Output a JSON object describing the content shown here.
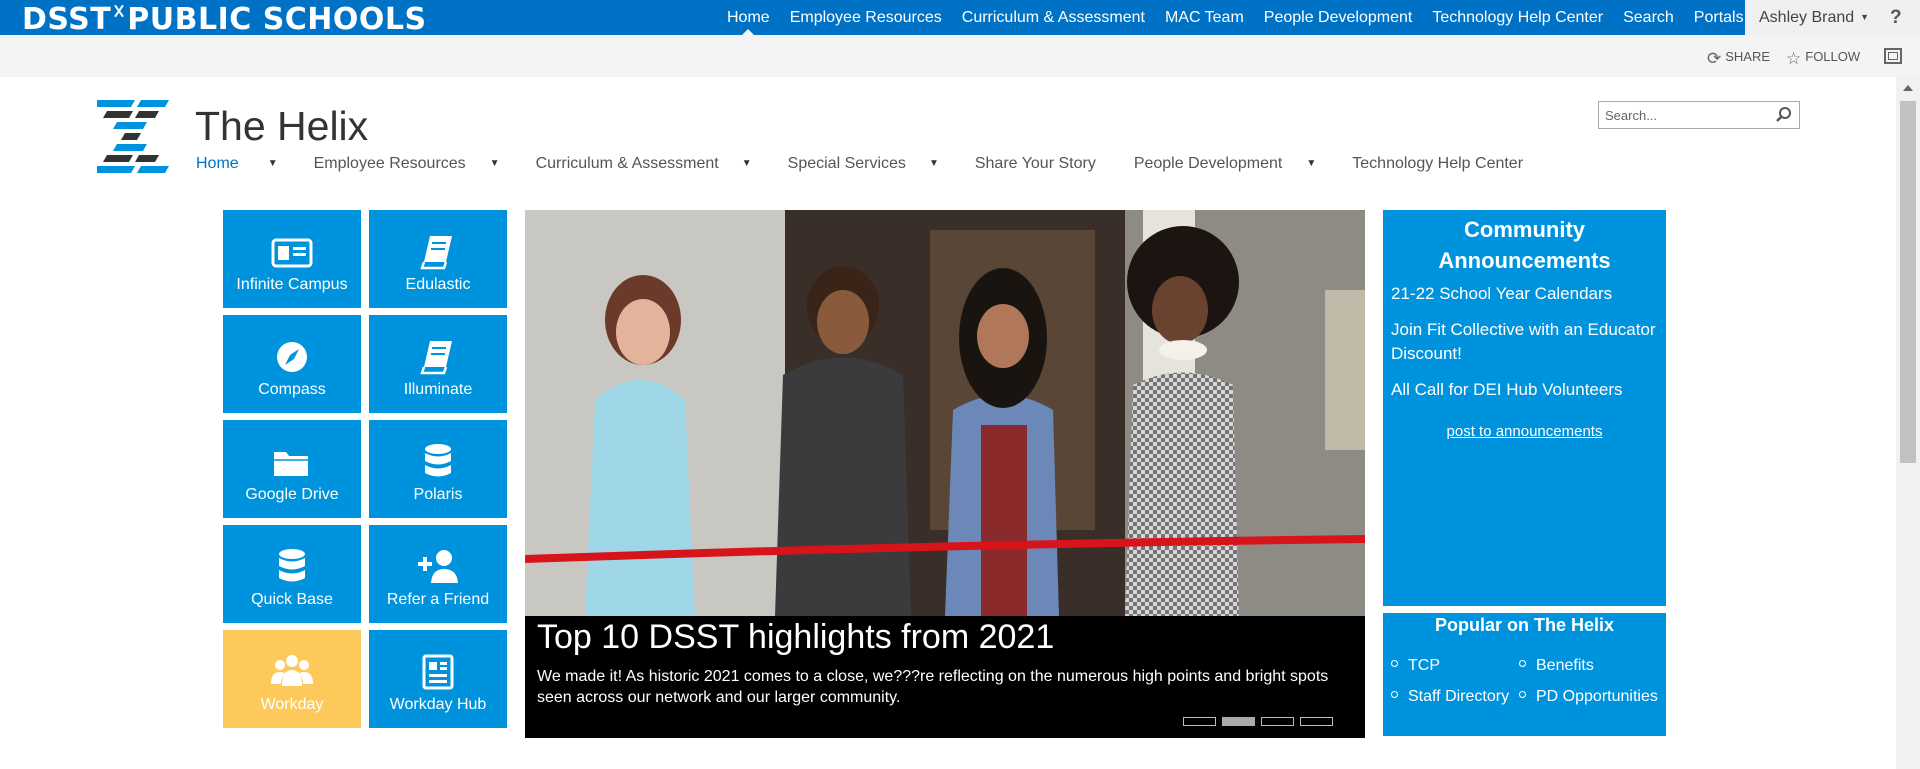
{
  "suite": {
    "brand_left": "DSST",
    "brand_right": "PUBLIC SCHOOLS",
    "nav": [
      {
        "label": "Home"
      },
      {
        "label": "Employee Resources"
      },
      {
        "label": "Curriculum & Assessment"
      },
      {
        "label": "MAC Team"
      },
      {
        "label": "People Development"
      },
      {
        "label": "Technology Help Center"
      },
      {
        "label": "Search"
      },
      {
        "label": "Portals"
      }
    ],
    "user": "Ashley Brand",
    "help": "?"
  },
  "ribbon": {
    "share": "SHARE",
    "follow": "FOLLOW"
  },
  "site": {
    "title": "The Helix",
    "nav": [
      {
        "label": "Home"
      },
      {
        "label": "Employee Resources"
      },
      {
        "label": "Curriculum & Assessment"
      },
      {
        "label": "Special Services"
      },
      {
        "label": "Share Your Story"
      },
      {
        "label": "People Development"
      },
      {
        "label": "Technology Help Center"
      }
    ],
    "search_placeholder": "Search..."
  },
  "tiles": [
    {
      "label": "Infinite Campus",
      "icon": "id-card-icon"
    },
    {
      "label": "Edulastic",
      "icon": "book-icon"
    },
    {
      "label": "Compass",
      "icon": "compass-icon"
    },
    {
      "label": "Illuminate",
      "icon": "book-icon"
    },
    {
      "label": "Google Drive",
      "icon": "folder-icon"
    },
    {
      "label": "Polaris",
      "icon": "database-icon"
    },
    {
      "label": "Quick Base",
      "icon": "database-icon"
    },
    {
      "label": "Refer a Friend",
      "icon": "add-user-icon"
    },
    {
      "label": "Workday",
      "icon": "users-icon"
    },
    {
      "label": "Workday Hub",
      "icon": "newspaper-icon"
    }
  ],
  "carousel": {
    "title": "Top 10 DSST highlights from 2021",
    "text": "We made it! As historic 2021 comes to a close, we???re reflecting on the numerous high points and bright spots seen across our network and our larger community.",
    "slides": 4,
    "active_slide": 2
  },
  "announcements": {
    "title": "Community Announcements",
    "items": [
      "21-22 School Year Calendars",
      "Join Fit Collective with an Educator Discount!",
      "All Call for DEI Hub Volunteers"
    ],
    "post_link": "post to announcements"
  },
  "popular": {
    "title": "Popular on The Helix",
    "links": [
      "TCP",
      "Benefits",
      "Staff Directory",
      "PD Opportunities"
    ]
  },
  "colors": {
    "suite_blue": "#0072c6",
    "tile_blue": "#0093dd",
    "tile_yellow": "#fdc95a"
  }
}
